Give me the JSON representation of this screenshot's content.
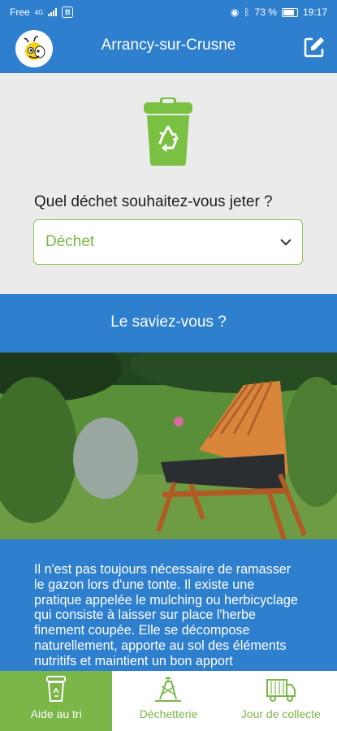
{
  "status_bar": {
    "carrier": "Free",
    "network": "4G",
    "badge": "B",
    "battery": "73 %",
    "time": "19:17"
  },
  "header": {
    "title": "Arrancy-sur-Crusne",
    "edit_icon": "edit-icon",
    "logo_icon": "bee-logo-icon"
  },
  "main": {
    "question": "Quel déchet souhaitez-vous jeter ?",
    "select_value": "Déchet"
  },
  "info": {
    "heading": "Le saviez-vous ?",
    "text": "Il n'est pas toujours nécessaire de ramasser le gazon lors d'une tonte. Il existe une pratique appelée le mulching ou herbicyclage qui consiste à laisser sur place l'herbe finement coupée. Elle se décompose naturellement, apporte au sol des éléments nutritifs et maintient un bon apport"
  },
  "nav": {
    "items": [
      {
        "label": "Aide au tri",
        "icon": "bin-icon",
        "active": true
      },
      {
        "label": "Déchetterie",
        "icon": "recycling-center-icon",
        "active": false
      },
      {
        "label": "Jour de collecte",
        "icon": "truck-icon",
        "active": false
      }
    ]
  },
  "colors": {
    "primary": "#2f7fcf",
    "accent": "#7ab648"
  }
}
